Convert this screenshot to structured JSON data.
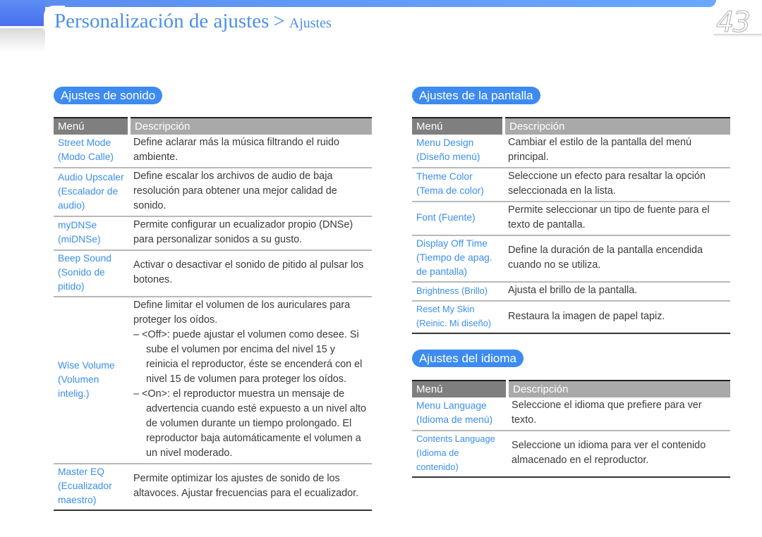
{
  "header": {
    "title_main": "Personalización de ajustes",
    "separator": ">",
    "title_sub": "Ajustes",
    "page_number": "43"
  },
  "colors": {
    "accent": "#3d8bf0",
    "link_text": "#3a8ef0",
    "header_menu_bg": "#7f7f7f",
    "header_desc_bg": "#a9a9a9"
  },
  "sound": {
    "heading": "Ajustes de sonido",
    "col_menu": "Menú",
    "col_desc": "Descripción",
    "rows": [
      {
        "menu": [
          "Street Mode",
          "(Modo Calle)"
        ],
        "desc": "Define aclarar más la música filtrando el ruido ambiente."
      },
      {
        "menu": [
          "Audio Upscaler",
          "(Escalador de",
          "audio)"
        ],
        "desc": "Define escalar los archivos de audio de baja resolución para obtener una mejor calidad de sonido."
      },
      {
        "menu": [
          "myDNSe",
          "(miDNSe)"
        ],
        "desc": "Permite configurar un ecualizador propio (DNSe) para personalizar sonidos a su gusto."
      },
      {
        "menu": [
          "Beep Sound",
          "(Sonido de",
          "pitido)"
        ],
        "desc": "Activar o desactivar el sonido de pitido al pulsar los botones."
      },
      {
        "menu": [
          "Wise Volume",
          "(Volumen",
          "intelig.)"
        ],
        "desc": "Define limitar el volumen de los auriculares para proteger los oídos.",
        "bullets": [
          "– <Off>: puede ajustar el volumen como desee. Si sube el volumen por encima del nivel 15 y reinicia el reproductor, éste se encenderá con el nivel 15 de volumen para proteger los oídos.",
          "– <On>: el reproductor muestra un mensaje de advertencia cuando esté expuesto a un nivel alto de volumen durante un tiempo prolongado. El reproductor baja automáticamente el volumen a un nivel moderado."
        ]
      },
      {
        "menu": [
          "Master EQ",
          "(Ecualizador",
          "maestro)"
        ],
        "desc": "Permite optimizar los ajustes de sonido de los altavoces. Ajustar frecuencias para el ecualizador."
      }
    ]
  },
  "display": {
    "heading": "Ajustes de la pantalla",
    "col_menu": "Menú",
    "col_desc": "Descripción",
    "rows": [
      {
        "menu": [
          "Menu Design",
          "(Diseño menú)"
        ],
        "desc": "Cambiar el estilo de la pantalla del menú principal."
      },
      {
        "menu": [
          "Theme Color",
          "(Tema de color)"
        ],
        "desc": "Seleccione un efecto para resaltar la opción seleccionada en la lista."
      },
      {
        "menu": [
          "Font (Fuente)"
        ],
        "desc": "Permite seleccionar un tipo de fuente para el texto de pantalla."
      },
      {
        "menu": [
          "Display Off Time",
          "(Tiempo de apag.",
          "de pantalla)"
        ],
        "desc": "Define la duración de la pantalla encendida cuando no se utiliza."
      },
      {
        "menu": [
          "Brightness (Brillo)"
        ],
        "desc": "Ajusta el brillo de la pantalla."
      },
      {
        "menu": [
          "Reset My Skin",
          "(Reinic. Mi diseño)"
        ],
        "desc": "Restaura la imagen de papel tapiz."
      }
    ]
  },
  "language": {
    "heading": "Ajustes del idioma",
    "col_menu": "Menú",
    "col_desc": "Descripción",
    "rows": [
      {
        "menu": [
          "Menu Language",
          "(Idioma de menú)"
        ],
        "desc": "Seleccione el idioma que prefiere para ver texto."
      },
      {
        "menu": [
          "Contents Language",
          "(Idioma de contenido)"
        ],
        "desc": "Seleccione un idioma para ver el contenido almacenado en el reproductor."
      }
    ]
  }
}
